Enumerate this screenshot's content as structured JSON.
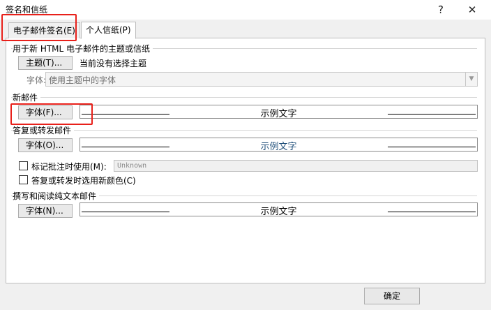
{
  "window": {
    "title": "签名和信纸",
    "help": "?",
    "close": "✕"
  },
  "tabs": [
    {
      "label": "电子邮件签名(E)"
    },
    {
      "label": "个人信纸(P)"
    }
  ],
  "theme_section": {
    "heading": "用于新 HTML 电子邮件的主题或信纸",
    "theme_button": "主题(T)...",
    "theme_status": "当前没有选择主题",
    "font_label": "字体:",
    "font_value": "使用主题中的字体"
  },
  "new_mail": {
    "heading": "新邮件",
    "font_button": "字体(F)...",
    "sample": "示例文字"
  },
  "reply": {
    "heading": "答复或转发邮件",
    "font_button": "字体(O)...",
    "sample": "示例文字",
    "mark_label": "标记批注时使用(M):",
    "mark_value": "Unknown",
    "color_label": "答复或转发时选用新颜色(C)"
  },
  "plain": {
    "heading": "撰写和阅读纯文本邮件",
    "font_button": "字体(N)...",
    "sample": "示例文字"
  },
  "footer": {
    "ok": "确定"
  },
  "colors": {
    "highlight": "#e8201a",
    "reply_sample": "#1f4e79"
  }
}
